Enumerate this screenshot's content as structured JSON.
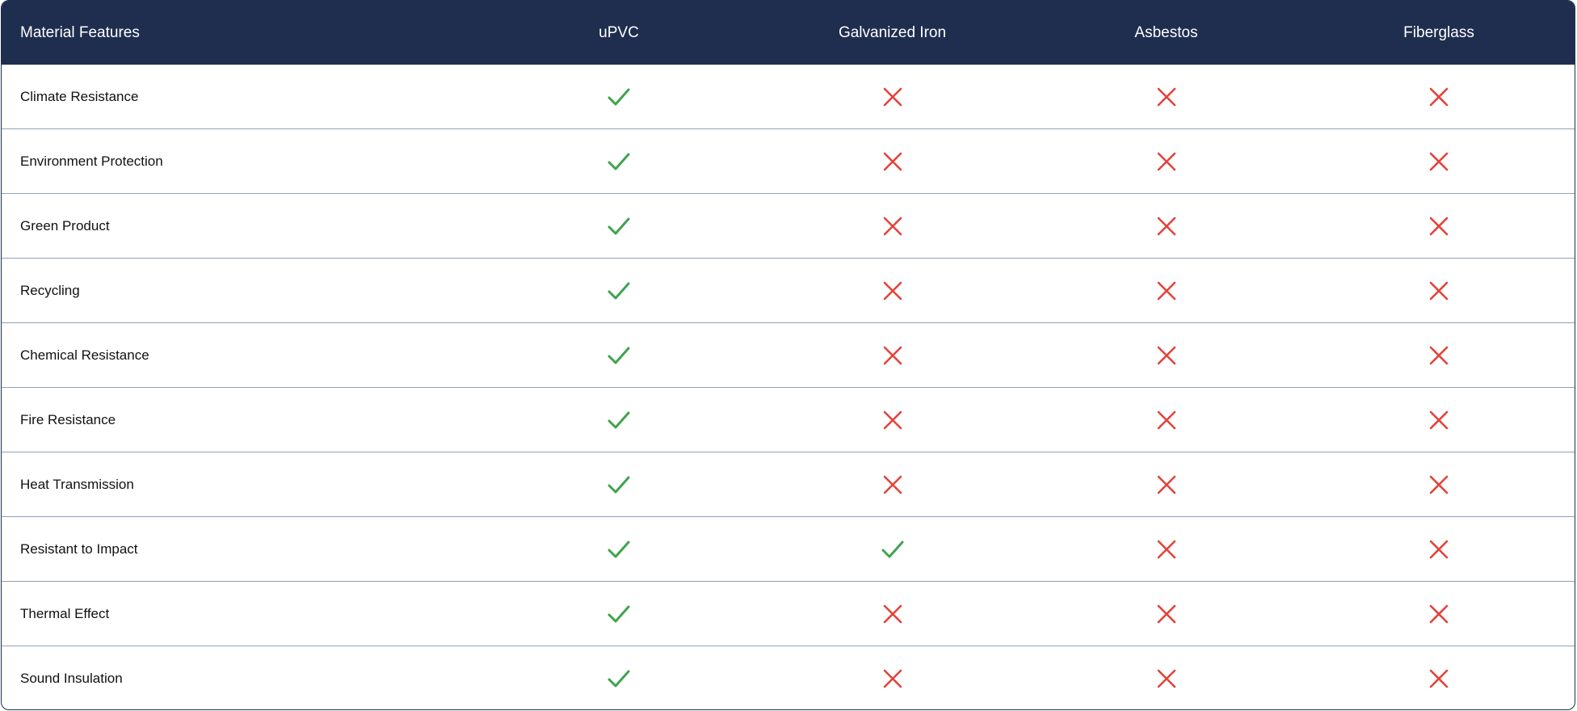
{
  "header": {
    "feature_label": "Material Features",
    "materials": [
      "uPVC",
      "Galvanized Iron",
      "Asbestos",
      "Fiberglass"
    ]
  },
  "rows": [
    {
      "feature": "Climate Resistance",
      "values": [
        true,
        false,
        false,
        false
      ]
    },
    {
      "feature": "Environment Protection",
      "values": [
        true,
        false,
        false,
        false
      ]
    },
    {
      "feature": "Green Product",
      "values": [
        true,
        false,
        false,
        false
      ]
    },
    {
      "feature": "Recycling",
      "values": [
        true,
        false,
        false,
        false
      ]
    },
    {
      "feature": "Chemical Resistance",
      "values": [
        true,
        false,
        false,
        false
      ]
    },
    {
      "feature": "Fire Resistance",
      "values": [
        true,
        false,
        false,
        false
      ]
    },
    {
      "feature": "Heat Transmission",
      "values": [
        true,
        false,
        false,
        false
      ]
    },
    {
      "feature": "Resistant to Impact",
      "values": [
        true,
        true,
        false,
        false
      ]
    },
    {
      "feature": "Thermal Effect",
      "values": [
        true,
        false,
        false,
        false
      ]
    },
    {
      "feature": "Sound Insulation",
      "values": [
        true,
        false,
        false,
        false
      ]
    }
  ],
  "colors": {
    "header_bg": "#1f2e4f",
    "check": "#3fa34d",
    "cross": "#e2443b",
    "row_divider": "#8fa2b8"
  },
  "icons": {
    "yes": "check-icon",
    "no": "cross-icon"
  }
}
